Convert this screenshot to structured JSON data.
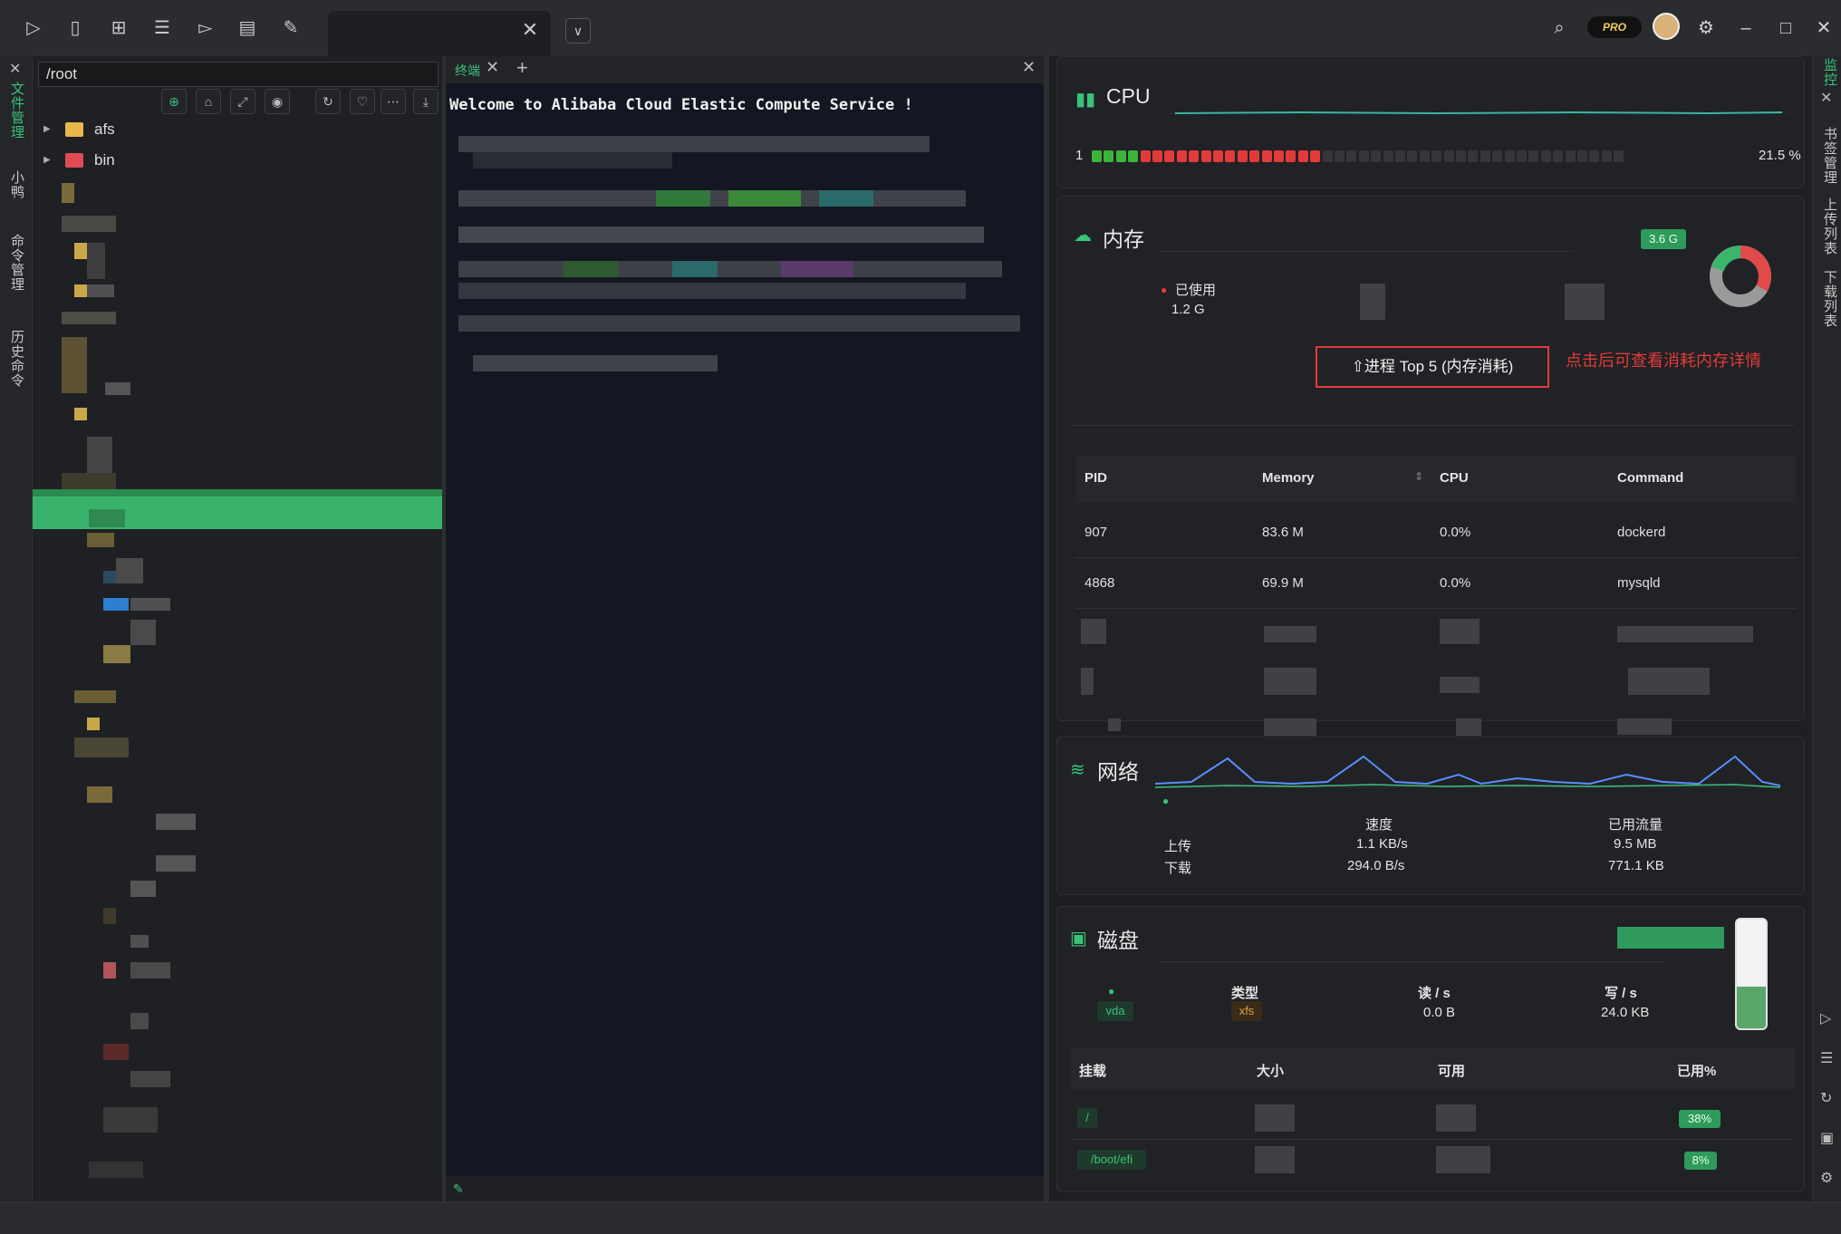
{
  "topbar": {
    "icons": [
      "terminal-icon",
      "bookmark-icon",
      "layout-icon",
      "tree-icon",
      "shell-icon",
      "list-icon",
      "wrench-icon"
    ],
    "tab_close": "✕",
    "pro_label": "PRO"
  },
  "left_vtabs": [
    "文件管理",
    "小鸭",
    "命令管理",
    "历史命令"
  ],
  "right_vtabs": [
    "监控",
    "书签管理",
    "上传列表",
    "下载列表"
  ],
  "filepanel": {
    "path": "/root",
    "tree": [
      {
        "name": "afs",
        "type": "folder"
      },
      {
        "name": "bin",
        "type": "folder-red"
      }
    ]
  },
  "terminal": {
    "tab_label": "终端",
    "welcome": "Welcome to Alibaba Cloud Elastic Compute Service !"
  },
  "monitor": {
    "cpu": {
      "title": "CPU",
      "core_index": "1",
      "usage": "21.5 %",
      "usage_fraction": 0.215
    },
    "memory": {
      "title": "内存",
      "total_badge": "3.6 G",
      "used_label": "已使用",
      "used_value": "1.2 G",
      "top5_button": "⇧进程 Top 5 (内存消耗)",
      "top5_note": "点击后可查看消耗内存详情",
      "table": {
        "headers": [
          "PID",
          "Memory",
          "CPU",
          "Command"
        ],
        "rows": [
          [
            "907",
            "83.6 M",
            "0.0%",
            "dockerd"
          ],
          [
            "4868",
            "69.9 M",
            "0.0%",
            "mysqld"
          ]
        ]
      },
      "donut_used_fraction": 0.33
    },
    "network": {
      "title": "网络",
      "speed_header": "速度",
      "traffic_header": "已用流量",
      "upload_label": "上传",
      "download_label": "下载",
      "upload_speed": "1.1 KB/s",
      "download_speed": "294.0 B/s",
      "upload_traffic": "9.5 MB",
      "download_traffic": "771.1 KB"
    },
    "disk": {
      "title": "磁盘",
      "device": "vda",
      "type_header": "类型",
      "read_header": "读 / s",
      "write_header": "写 / s",
      "fs_type": "xfs",
      "read_value": "0.0 B",
      "write_value": "24.0 KB",
      "level_fraction": 0.38,
      "table": {
        "headers": [
          "挂载",
          "大小",
          "可用",
          "已用%"
        ],
        "rows": [
          {
            "mount": "/",
            "used_pct": "38%"
          },
          {
            "mount": "/boot/efi",
            "used_pct": "8%"
          }
        ]
      }
    }
  },
  "colors": {
    "accent": "#3ac27a",
    "alert": "#e23a3a",
    "cpu_green": "#3ab53a",
    "cpu_red": "#e23a3a",
    "net_blue": "#5b8cff"
  }
}
